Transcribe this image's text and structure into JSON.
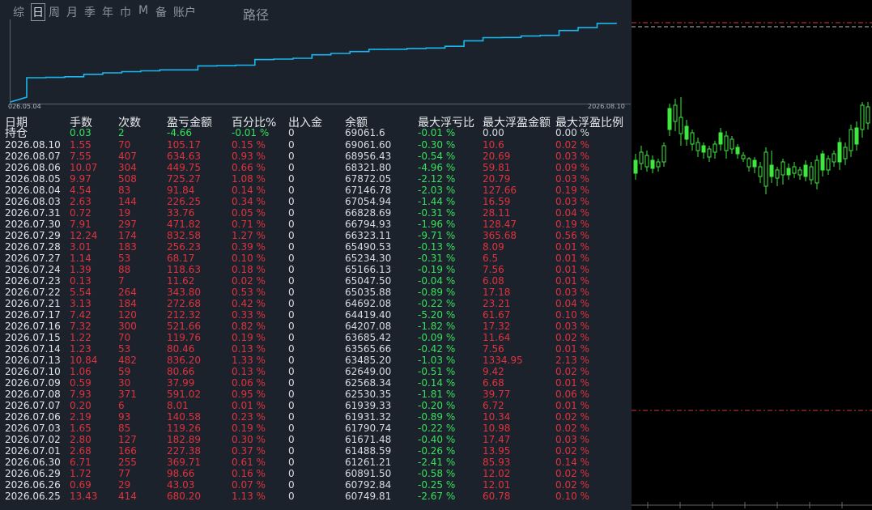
{
  "period_tabs": [
    "综",
    "日",
    "周",
    "月",
    "季",
    "年",
    "巾",
    "M",
    "备",
    "账户"
  ],
  "active_tab": "日",
  "extra_label": "路径",
  "equity_curve": {
    "start_date": "026.05.04",
    "end_date": "2026.08.10",
    "line_color": "#19b8f0"
  },
  "columns": [
    "日期",
    "手数",
    "次数",
    "盈亏金额",
    "百分比%",
    "出入金",
    "余额",
    "最大浮亏比",
    "最大浮盈金额",
    "最大浮盈比例"
  ],
  "holding": {
    "label": "持仓",
    "lots": "0.03",
    "count": "2",
    "pnl": "-4.66",
    "pct": "-0.01 %",
    "flow": "0",
    "balance": "69061.6",
    "max_loss_ratio": "-0.01 %",
    "max_profit_amount": "0.00",
    "max_profit_ratio": "0.00 %"
  },
  "rows": [
    [
      "2026.08.10",
      "1.55",
      "70",
      "105.17",
      "0.15 %",
      "0",
      "69061.60",
      "-0.30 %",
      "10.6",
      "0.02 %"
    ],
    [
      "2026.08.07",
      "7.55",
      "407",
      "634.63",
      "0.93 %",
      "0",
      "68956.43",
      "-0.54 %",
      "20.69",
      "0.03 %"
    ],
    [
      "2026.08.06",
      "10.07",
      "304",
      "449.75",
      "0.66 %",
      "0",
      "68321.80",
      "-4.96 %",
      "59.81",
      "0.09 %"
    ],
    [
      "2026.08.05",
      "9.97",
      "508",
      "725.27",
      "1.08 %",
      "0",
      "67872.05",
      "-2.12 %",
      "20.79",
      "0.03 %"
    ],
    [
      "2026.08.04",
      "4.54",
      "83",
      "91.84",
      "0.14 %",
      "0",
      "67146.78",
      "-2.03 %",
      "127.66",
      "0.19 %"
    ],
    [
      "2026.08.03",
      "2.63",
      "144",
      "226.25",
      "0.34 %",
      "0",
      "67054.94",
      "-1.44 %",
      "16.59",
      "0.03 %"
    ],
    [
      "2026.07.31",
      "0.72",
      "19",
      "33.76",
      "0.05 %",
      "0",
      "66828.69",
      "-0.31 %",
      "28.11",
      "0.04 %"
    ],
    [
      "2026.07.30",
      "7.91",
      "297",
      "471.82",
      "0.71 %",
      "0",
      "66794.93",
      "-1.96 %",
      "128.47",
      "0.19 %"
    ],
    [
      "2026.07.29",
      "12.24",
      "174",
      "832.58",
      "1.27 %",
      "0",
      "66323.11",
      "-9.71 %",
      "365.68",
      "0.56 %"
    ],
    [
      "2026.07.28",
      "3.01",
      "183",
      "256.23",
      "0.39 %",
      "0",
      "65490.53",
      "-0.13 %",
      "8.09",
      "0.01 %"
    ],
    [
      "2026.07.27",
      "1.14",
      "53",
      "68.17",
      "0.10 %",
      "0",
      "65234.30",
      "-0.31 %",
      "6.5",
      "0.01 %"
    ],
    [
      "2026.07.24",
      "1.39",
      "88",
      "118.63",
      "0.18 %",
      "0",
      "65166.13",
      "-0.19 %",
      "7.56",
      "0.01 %"
    ],
    [
      "2026.07.23",
      "0.13",
      "7",
      "11.62",
      "0.02 %",
      "0",
      "65047.50",
      "-0.04 %",
      "6.08",
      "0.01 %"
    ],
    [
      "2026.07.22",
      "5.54",
      "264",
      "343.80",
      "0.53 %",
      "0",
      "65035.88",
      "-0.89 %",
      "17.18",
      "0.03 %"
    ],
    [
      "2026.07.21",
      "3.13",
      "184",
      "272.68",
      "0.42 %",
      "0",
      "64692.08",
      "-0.22 %",
      "23.21",
      "0.04 %"
    ],
    [
      "2026.07.17",
      "7.42",
      "120",
      "212.32",
      "0.33 %",
      "0",
      "64419.40",
      "-5.20 %",
      "61.67",
      "0.10 %"
    ],
    [
      "2026.07.16",
      "7.32",
      "300",
      "521.66",
      "0.82 %",
      "0",
      "64207.08",
      "-1.82 %",
      "17.32",
      "0.03 %"
    ],
    [
      "2026.07.15",
      "1.22",
      "70",
      "119.76",
      "0.19 %",
      "0",
      "63685.42",
      "-0.09 %",
      "11.64",
      "0.02 %"
    ],
    [
      "2026.07.14",
      "1.23",
      "53",
      "80.46",
      "0.13 %",
      "0",
      "63565.66",
      "-0.42 %",
      "7.56",
      "0.01 %"
    ],
    [
      "2026.07.13",
      "10.84",
      "482",
      "836.20",
      "1.33 %",
      "0",
      "63485.20",
      "-1.03 %",
      "1334.95",
      "2.13 %"
    ],
    [
      "2026.07.10",
      "1.06",
      "59",
      "80.66",
      "0.13 %",
      "0",
      "62649.00",
      "-0.51 %",
      "9.42",
      "0.02 %"
    ],
    [
      "2026.07.09",
      "0.59",
      "30",
      "37.99",
      "0.06 %",
      "0",
      "62568.34",
      "-0.14 %",
      "6.68",
      "0.01 %"
    ],
    [
      "2026.07.08",
      "7.93",
      "371",
      "591.02",
      "0.95 %",
      "0",
      "62530.35",
      "-1.81 %",
      "39.77",
      "0.06 %"
    ],
    [
      "2026.07.07",
      "0.20",
      "6",
      "8.01",
      "0.01 %",
      "0",
      "61939.33",
      "-0.20 %",
      "6.72",
      "0.01 %"
    ],
    [
      "2026.07.06",
      "2.19",
      "93",
      "140.58",
      "0.23 %",
      "0",
      "61931.32",
      "-0.89 %",
      "10.34",
      "0.02 %"
    ],
    [
      "2026.07.03",
      "1.65",
      "85",
      "119.26",
      "0.19 %",
      "0",
      "61790.74",
      "-0.22 %",
      "10.98",
      "0.02 %"
    ],
    [
      "2026.07.02",
      "2.80",
      "127",
      "182.89",
      "0.30 %",
      "0",
      "61671.48",
      "-0.40 %",
      "17.47",
      "0.03 %"
    ],
    [
      "2026.07.01",
      "2.68",
      "166",
      "227.38",
      "0.37 %",
      "0",
      "61488.59",
      "-0.26 %",
      "13.95",
      "0.02 %"
    ],
    [
      "2026.06.30",
      "6.71",
      "255",
      "369.71",
      "0.61 %",
      "0",
      "61261.21",
      "-2.41 %",
      "85.93",
      "0.14 %"
    ],
    [
      "2026.06.29",
      "1.72",
      "77",
      "98.66",
      "0.16 %",
      "0",
      "60891.50",
      "-0.58 %",
      "12.02",
      "0.02 %"
    ],
    [
      "2026.06.26",
      "0.69",
      "29",
      "43.03",
      "0.07 %",
      "0",
      "60792.84",
      "-0.25 %",
      "12.01",
      "0.02 %"
    ],
    [
      "2026.06.25",
      "13.43",
      "414",
      "680.20",
      "1.13 %",
      "0",
      "60749.81",
      "-2.67 %",
      "60.78",
      "0.10 %"
    ]
  ],
  "colors": {
    "panel_bg": "#1b222b",
    "positive": "#38e05b",
    "negative": "#e2323d",
    "candle": "#3ee83e",
    "level_line": "#d63a3a"
  }
}
